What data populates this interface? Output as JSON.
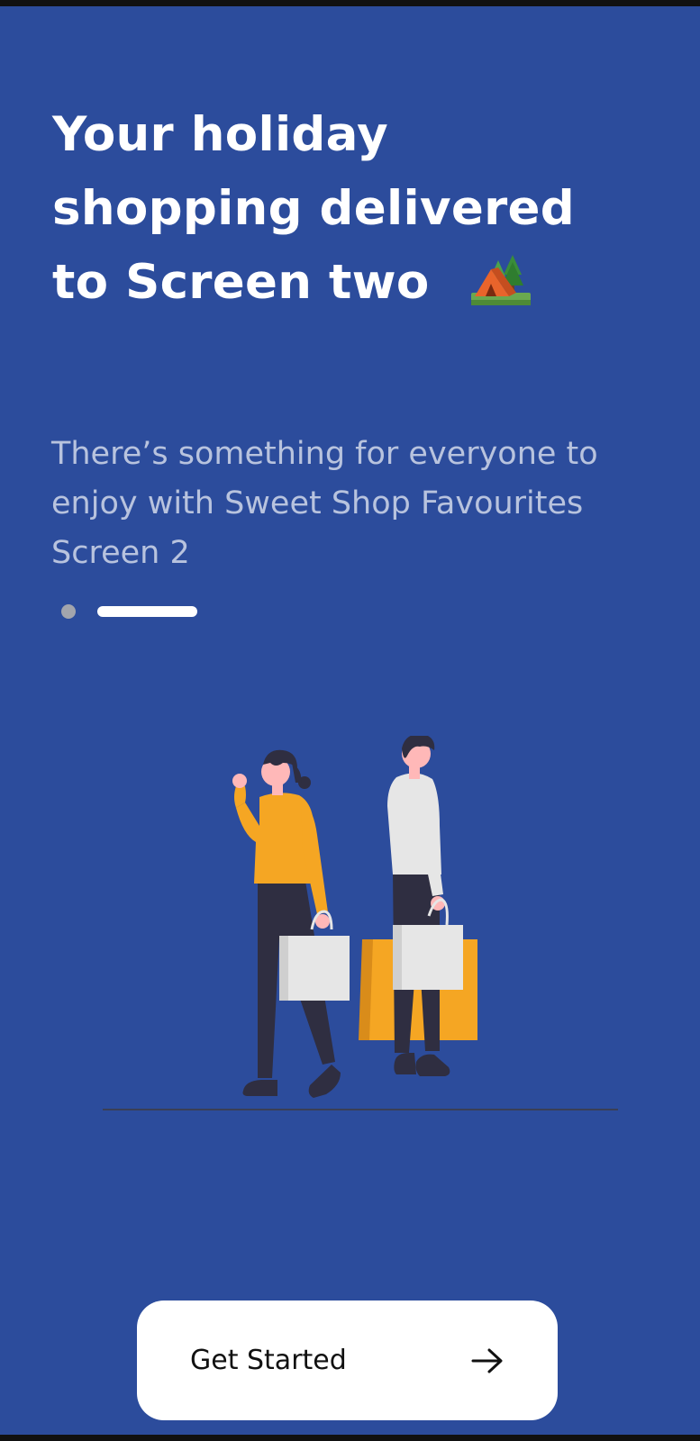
{
  "onboarding": {
    "headline": "Your holiday shopping delivered to Screen two",
    "headline_emoji_icon": "camping-tent-icon",
    "subtitle": "There’s something for everyone to enjoy with Sweet Shop Favourites Screen 2",
    "pager": {
      "total": 2,
      "active_index": 1
    },
    "illustration_icon": "shopping-couple-illustration",
    "cta": {
      "label": "Get Started",
      "icon": "arrow-right-icon"
    }
  },
  "colors": {
    "background": "#2c4c9c",
    "headline": "#ffffff",
    "subtitle": "#b8c3de",
    "button_bg": "#ffffff",
    "button_text": "#111111",
    "accent_orange": "#f5a623"
  }
}
